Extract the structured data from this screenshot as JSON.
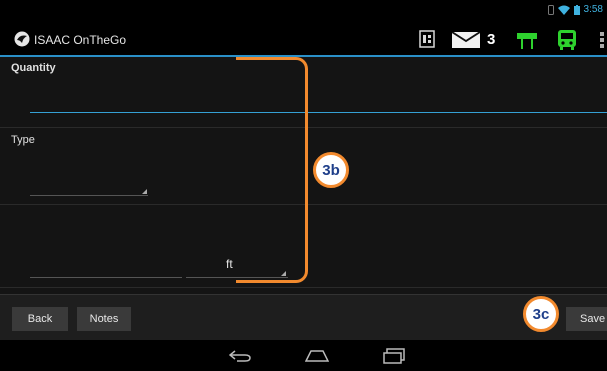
{
  "status_bar": {
    "time": "3:58"
  },
  "app": {
    "title": "ISAAC OnTheGo",
    "mail_count": "3"
  },
  "form": {
    "quantity_label": "Quantity",
    "quantity_value": "",
    "type_label": "Type",
    "type_value": "",
    "length_value": "",
    "unit_label": "ft"
  },
  "bottom_bar": {
    "back_label": "Back",
    "notes_label": "Notes",
    "save_label": "Save"
  },
  "annotations": {
    "callout_b": "3b",
    "callout_c": "3c"
  },
  "colors": {
    "accent_blue": "#35a0d4",
    "annotation_orange": "#f28a2e",
    "annotation_text": "#1f3f8a",
    "status_green": "#2ed12e"
  },
  "icons": [
    "app-logo-icon",
    "sim-card-icon",
    "mail-icon",
    "sign-icon",
    "bus-icon",
    "overflow-menu-icon",
    "back-nav-icon",
    "home-nav-icon",
    "recent-apps-icon",
    "wifi-icon",
    "battery-icon"
  ]
}
